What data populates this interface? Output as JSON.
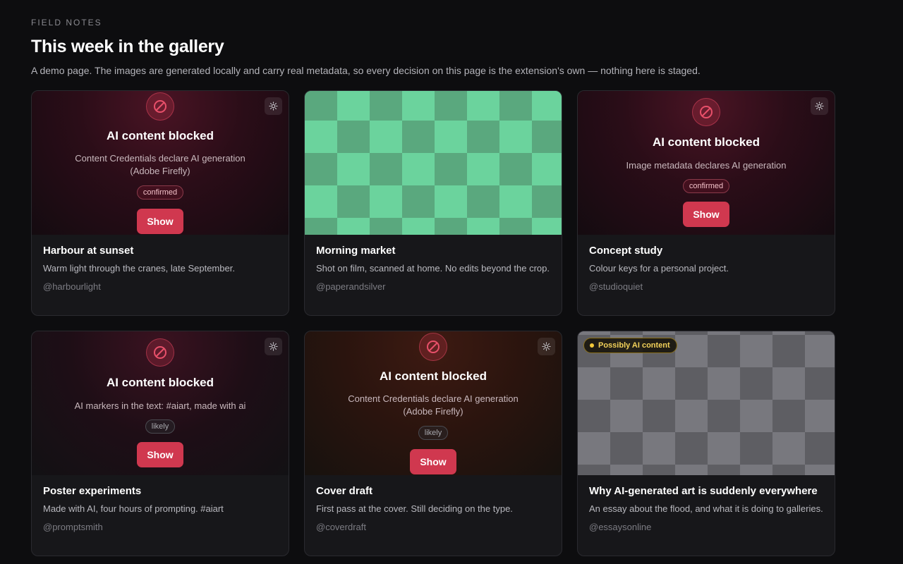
{
  "header": {
    "eyebrow": "FIELD NOTES",
    "title": "This week in the gallery",
    "subtitle": "A demo page. The images are generated locally and carry real metadata, so every decision on this page is the extension's own — nothing here is staged."
  },
  "colors": {
    "page_bg": "#0d0d0f",
    "card_bg": "#17171a",
    "accent_red": "#d0384f",
    "warning_yellow": "#f3d25a"
  },
  "cards": [
    {
      "title": "Harbour at sunset",
      "description": "Warm light through the cranes, late September.",
      "handle": "@harbourlight",
      "media": "blocked",
      "blocked": {
        "icon": "blocked-icon",
        "title": "AI content blocked",
        "reason": "Content Credentials declare AI generation (Adobe Firefly)",
        "badge": "confirmed",
        "button": "Show",
        "settings_icon": "settings-icon"
      }
    },
    {
      "title": "Morning market",
      "description": "Shot on film, scanned at home. No edits beyond the crop.",
      "handle": "@paperandsilver",
      "media": "image-green-checker"
    },
    {
      "title": "Concept study",
      "description": "Colour keys for a personal project.",
      "handle": "@studioquiet",
      "media": "blocked",
      "blocked": {
        "icon": "blocked-icon",
        "title": "AI content blocked",
        "reason": "Image metadata declares AI generation",
        "badge": "confirmed",
        "button": "Show",
        "settings_icon": "settings-icon"
      }
    },
    {
      "title": "Poster experiments",
      "description": "Made with AI, four hours of prompting. #aiart",
      "handle": "@promptsmith",
      "media": "blocked",
      "blocked": {
        "icon": "blocked-icon",
        "title": "AI content blocked",
        "reason": "AI markers in the text: #aiart, made with ai",
        "badge": "likely",
        "button": "Show",
        "settings_icon": "settings-icon"
      }
    },
    {
      "title": "Cover draft",
      "description": "First pass at the cover. Still deciding on the type.",
      "handle": "@coverdraft",
      "media": "blocked",
      "blocked": {
        "icon": "blocked-icon",
        "title": "AI content blocked",
        "reason": "Content Credentials declare AI generation (Adobe Firefly)",
        "badge": "likely",
        "button": "Show",
        "settings_icon": "settings-icon"
      }
    },
    {
      "title": "Why AI-generated art is suddenly everywhere",
      "description": "An essay about the flood, and what it is doing to galleries.",
      "handle": "@essaysonline",
      "media": "image-grey-checker",
      "pill": "Possibly AI content"
    }
  ]
}
